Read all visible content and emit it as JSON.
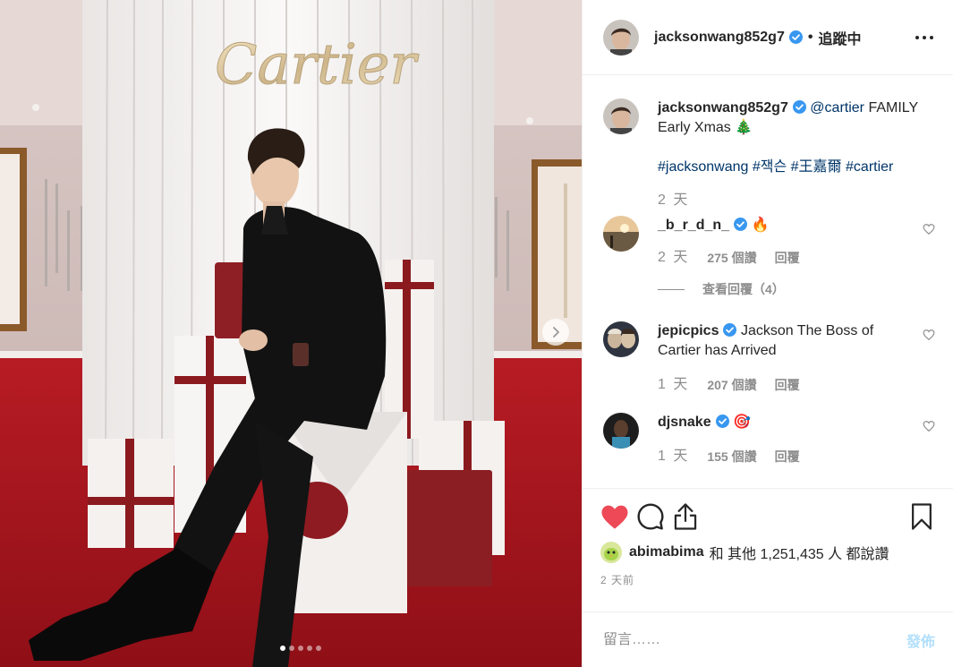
{
  "header": {
    "username": "jacksonwang852g7",
    "separator": "•",
    "follow_state": "追蹤中"
  },
  "caption": {
    "username": "jacksonwang852g7",
    "mention": "@cartier",
    "text": " FAMILY Early Xmas 🎄",
    "hashtags": [
      "#jacksonwang",
      "#잭슨",
      "#王嘉爾",
      "#cartier"
    ],
    "time": "2 天"
  },
  "comments": [
    {
      "username": "_b_r_d_n_",
      "text": "🔥",
      "time": "2 天",
      "likes": "275 個讚",
      "reply": "回覆",
      "view_replies": "查看回覆（4）"
    },
    {
      "username": "jepicpics",
      "text": "Jackson The Boss of Cartier has Arrived",
      "time": "1 天",
      "likes": "207 個讚",
      "reply": "回覆"
    },
    {
      "username": "djsnake",
      "text": "🎯",
      "time": "1 天",
      "likes": "155 個讚",
      "reply": "回覆"
    }
  ],
  "likes": {
    "username": "abimabima",
    "text": "和 其他 1,251,435 人 都說讚"
  },
  "posted_time": "2 天前",
  "add_comment": {
    "placeholder": "留言……",
    "publish": "發佈"
  },
  "photo": {
    "brand_text": "Cartier",
    "carousel_count": 5,
    "carousel_active": 1
  },
  "colors": {
    "like_red": "#ed4956",
    "link_blue": "#003569",
    "verified_blue": "#3897f0",
    "publish_disabled": "#b2dffc"
  }
}
